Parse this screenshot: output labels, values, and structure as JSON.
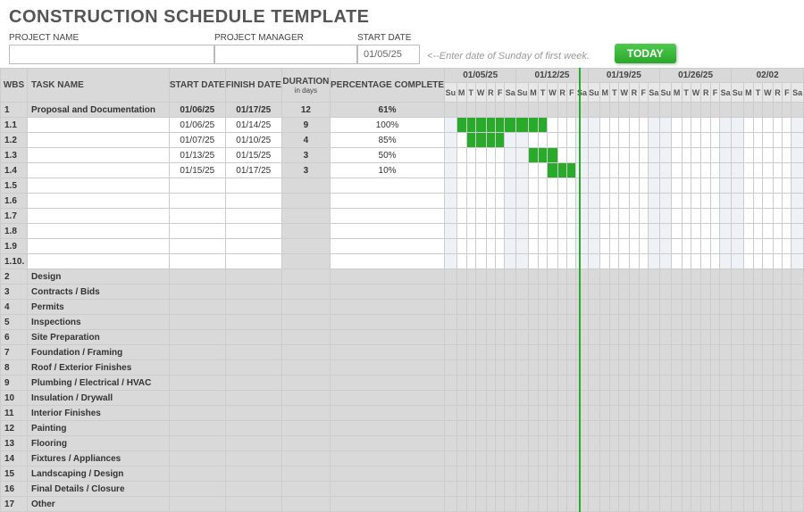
{
  "title": "CONSTRUCTION SCHEDULE TEMPLATE",
  "form": {
    "project_name_label": "PROJECT NAME",
    "project_name_value": "",
    "project_manager_label": "PROJECT MANAGER",
    "project_manager_value": "",
    "start_date_label": "START DATE",
    "start_date_value": "01/05/25",
    "hint": "<--Enter date of Sunday of first week.",
    "today_label": "TODAY"
  },
  "headers": {
    "wbs": "WBS",
    "task": "TASK NAME",
    "start": "START DATE",
    "finish": "FINISH DATE",
    "duration": "DURATION",
    "duration_sub": "in days",
    "percent": "PERCENTAGE COMPLETE"
  },
  "weeks": [
    "01/05/25",
    "01/12/25",
    "01/19/25",
    "01/26/25",
    "02/02"
  ],
  "days": [
    "Su",
    "M",
    "T",
    "W",
    "R",
    "F",
    "Sa"
  ],
  "rows": [
    {
      "wbs": "1",
      "task": "Proposal and Documentation",
      "start": "01/06/25",
      "finish": "01/17/25",
      "dur": "12",
      "pct": "61%",
      "gray": true,
      "bars": []
    },
    {
      "wbs": "1.1",
      "task": "",
      "start": "01/06/25",
      "finish": "01/14/25",
      "dur": "9",
      "pct": "100%",
      "bars": [
        1,
        2,
        3,
        4,
        5,
        6,
        7,
        8,
        9
      ]
    },
    {
      "wbs": "1.2",
      "task": "",
      "start": "01/07/25",
      "finish": "01/10/25",
      "dur": "4",
      "pct": "85%",
      "bars": [
        2,
        3,
        4,
        5
      ]
    },
    {
      "wbs": "1.3",
      "task": "",
      "start": "01/13/25",
      "finish": "01/15/25",
      "dur": "3",
      "pct": "50%",
      "bars": [
        8,
        9,
        10
      ]
    },
    {
      "wbs": "1.4",
      "task": "",
      "start": "01/15/25",
      "finish": "01/17/25",
      "dur": "3",
      "pct": "10%",
      "bars": [
        10,
        11,
        12
      ]
    },
    {
      "wbs": "1.5",
      "task": "",
      "start": "",
      "finish": "",
      "dur": "",
      "pct": ""
    },
    {
      "wbs": "1.6",
      "task": "",
      "start": "",
      "finish": "",
      "dur": "",
      "pct": ""
    },
    {
      "wbs": "1.7",
      "task": "",
      "start": "",
      "finish": "",
      "dur": "",
      "pct": ""
    },
    {
      "wbs": "1.8",
      "task": "",
      "start": "",
      "finish": "",
      "dur": "",
      "pct": ""
    },
    {
      "wbs": "1.9",
      "task": "",
      "start": "",
      "finish": "",
      "dur": "",
      "pct": ""
    },
    {
      "wbs": "1.10.",
      "task": "",
      "start": "",
      "finish": "",
      "dur": "",
      "pct": ""
    },
    {
      "wbs": "2",
      "task": "Design",
      "gray": true
    },
    {
      "wbs": "3",
      "task": "Contracts / Bids",
      "gray": true
    },
    {
      "wbs": "4",
      "task": "Permits",
      "gray": true
    },
    {
      "wbs": "5",
      "task": "Inspections",
      "gray": true
    },
    {
      "wbs": "6",
      "task": "Site Preparation",
      "gray": true
    },
    {
      "wbs": "7",
      "task": "Foundation / Framing",
      "gray": true
    },
    {
      "wbs": "8",
      "task": "Roof / Exterior Finishes",
      "gray": true
    },
    {
      "wbs": "9",
      "task": "Plumbing / Electrical / HVAC",
      "gray": true
    },
    {
      "wbs": "10",
      "task": "Insulation / Drywall",
      "gray": true
    },
    {
      "wbs": "11",
      "task": "Interior Finishes",
      "gray": true
    },
    {
      "wbs": "12",
      "task": "Painting",
      "gray": true
    },
    {
      "wbs": "13",
      "task": "Flooring",
      "gray": true
    },
    {
      "wbs": "14",
      "task": "Fixtures / Appliances",
      "gray": true
    },
    {
      "wbs": "15",
      "task": "Landscaping / Design",
      "gray": true
    },
    {
      "wbs": "16",
      "task": "Final Details / Closure",
      "gray": true
    },
    {
      "wbs": "17",
      "task": "Other",
      "gray": true
    }
  ],
  "today_col": 14,
  "chart_data": {
    "type": "gantt",
    "title": "Construction Schedule",
    "x_start": "2025-01-05",
    "days_per_tick": 1,
    "tasks": [
      {
        "id": "1",
        "name": "Proposal and Documentation",
        "start": "2025-01-06",
        "finish": "2025-01-17",
        "duration": 12,
        "pct_complete": 61,
        "summary": true
      },
      {
        "id": "1.1",
        "name": "",
        "start": "2025-01-06",
        "finish": "2025-01-14",
        "duration": 9,
        "pct_complete": 100
      },
      {
        "id": "1.2",
        "name": "",
        "start": "2025-01-07",
        "finish": "2025-01-10",
        "duration": 4,
        "pct_complete": 85
      },
      {
        "id": "1.3",
        "name": "",
        "start": "2025-01-13",
        "finish": "2025-01-15",
        "duration": 3,
        "pct_complete": 50
      },
      {
        "id": "1.4",
        "name": "",
        "start": "2025-01-15",
        "finish": "2025-01-17",
        "duration": 3,
        "pct_complete": 10
      }
    ]
  }
}
